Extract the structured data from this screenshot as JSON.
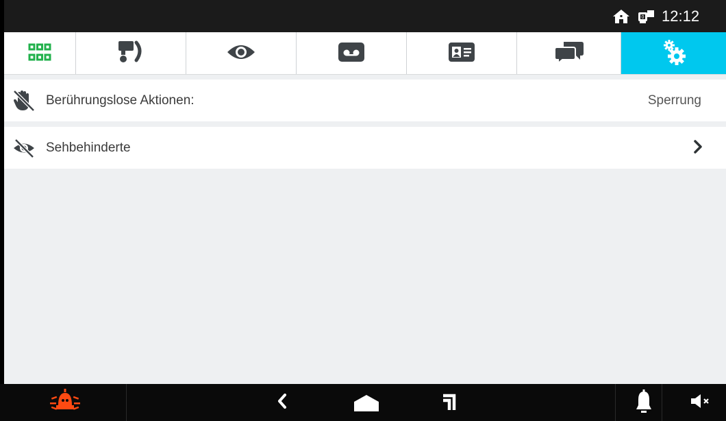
{
  "status": {
    "time": "12:12",
    "icons": [
      "home-icon",
      "intercom-device-icon"
    ]
  },
  "tabs": [
    {
      "name": "apps-grid",
      "icon": "grid-icon",
      "active": false
    },
    {
      "name": "intercom-call",
      "icon": "intercom-call-icon",
      "active": false
    },
    {
      "name": "view",
      "icon": "eye-icon",
      "active": false
    },
    {
      "name": "voicemail",
      "icon": "voicemail-icon",
      "active": false
    },
    {
      "name": "contacts",
      "icon": "contact-card-icon",
      "active": false
    },
    {
      "name": "messages",
      "icon": "chat-icon",
      "active": false
    },
    {
      "name": "settings",
      "icon": "gears-icon",
      "active": true
    }
  ],
  "settings": {
    "rows": [
      {
        "label": "Berührungslose Aktionen:",
        "value": "Sperrung",
        "icon": "touchless-icon"
      },
      {
        "label": "Sehbehinderte",
        "value": "",
        "icon": "visually-impaired-icon",
        "has_chevron": true
      }
    ]
  },
  "navbar": {
    "icons": [
      "alarm-icon",
      "back-icon",
      "home-icon",
      "recent-icon",
      "bell-icon",
      "mute-icon"
    ]
  },
  "colors": {
    "accent": "#00c8ee",
    "grid_icon": "#22b14c",
    "alarm": "#ff4a12"
  }
}
